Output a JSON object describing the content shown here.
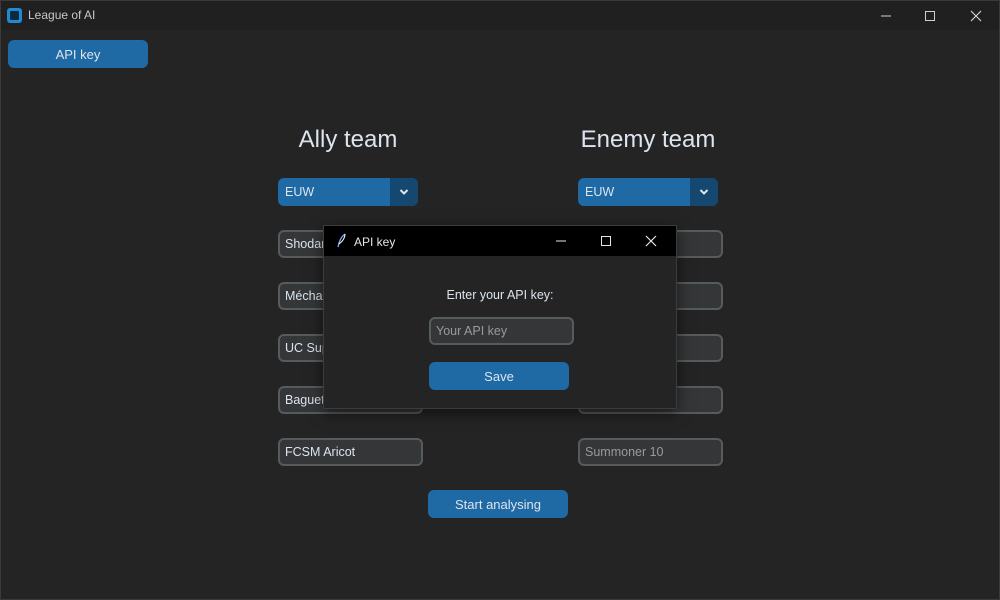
{
  "window": {
    "title": "League of AI"
  },
  "toolbar": {
    "api_key_label": "API key"
  },
  "ally": {
    "heading": "Ally team",
    "region": "EUW",
    "summoners": [
      "Shodan",
      "Mécha",
      "UC Sup",
      "Baguet",
      "FCSM Aricot"
    ]
  },
  "enemy": {
    "heading": "Enemy team",
    "region": "EUW",
    "summoner_last_placeholder": "Summoner 10"
  },
  "main": {
    "start_label": "Start analysing"
  },
  "dialog": {
    "title": "API key",
    "prompt": "Enter your API key:",
    "input_placeholder": "Your API key",
    "save_label": "Save"
  },
  "colors": {
    "accent": "#1f6aa5",
    "accent_dark": "#144870",
    "background": "#242424",
    "field_bg": "#343638",
    "field_border": "#565b5e"
  },
  "icons": [
    "app-icon",
    "minimize-icon",
    "maximize-icon",
    "close-icon",
    "chevron-down-icon",
    "feather-icon"
  ]
}
